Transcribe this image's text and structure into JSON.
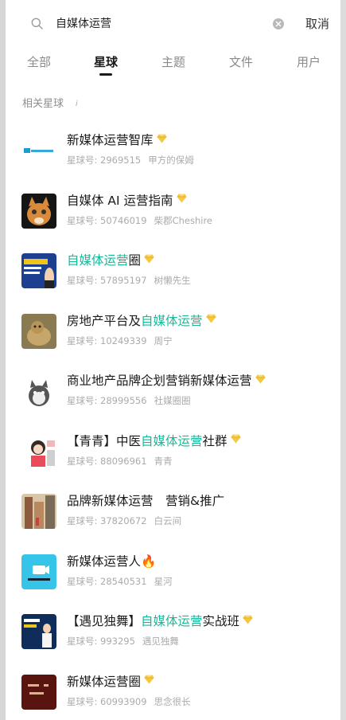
{
  "search": {
    "query": "自媒体运营",
    "cancel_label": "取消"
  },
  "tabs": [
    {
      "label": "全部"
    },
    {
      "label": "星球"
    },
    {
      "label": "主题"
    },
    {
      "label": "文件"
    },
    {
      "label": "用户"
    }
  ],
  "active_tab": "星球",
  "section": {
    "title": "相关星球",
    "info_glyph": "i"
  },
  "colors": {
    "highlight": "#16b998",
    "diamond": "#f5c842"
  },
  "results": [
    {
      "pre": "新媒体运营智库",
      "hl": "",
      "post": "",
      "id_label": "星球号:",
      "id": "2969515",
      "owner": "甲方的保姆"
    },
    {
      "pre": "自媒体 AI 运营指南",
      "hl": "",
      "post": "",
      "id_label": "星球号:",
      "id": "50746019",
      "owner": "柴郡Cheshire"
    },
    {
      "pre": "",
      "hl": "自媒体运营",
      "post": "圈",
      "id_label": "星球号:",
      "id": "57895197",
      "owner": "树懒先生"
    },
    {
      "pre": "房地产平台及",
      "hl": "自媒体运营",
      "post": "",
      "id_label": "星球号:",
      "id": "10249339",
      "owner": "周宁"
    },
    {
      "pre": "商业地产品牌企划营销新媒体运营",
      "hl": "",
      "post": "",
      "id_label": "星球号:",
      "id": "28999556",
      "owner": "社媒圈圈"
    },
    {
      "pre": "【青青】中医",
      "hl": "自媒体运营",
      "post": "社群",
      "id_label": "星球号:",
      "id": "88096961",
      "owner": "青青"
    },
    {
      "pre": "品牌新媒体运营　营销&推广",
      "hl": "",
      "post": "",
      "id_label": "星球号:",
      "id": "37820672",
      "owner": "白云间"
    },
    {
      "pre": "新媒体运营人🔥",
      "hl": "",
      "post": "",
      "id_label": "星球号:",
      "id": "28540531",
      "owner": "星河"
    },
    {
      "pre": "【遇见独舞】",
      "hl": "自媒体运营",
      "post": "实战班",
      "id_label": "星球号:",
      "id": "993295",
      "owner": "遇见独舞"
    },
    {
      "pre": "新媒体运营圈",
      "hl": "",
      "post": "",
      "id_label": "星球号:",
      "id": "60993909",
      "owner": "思念很长"
    }
  ]
}
